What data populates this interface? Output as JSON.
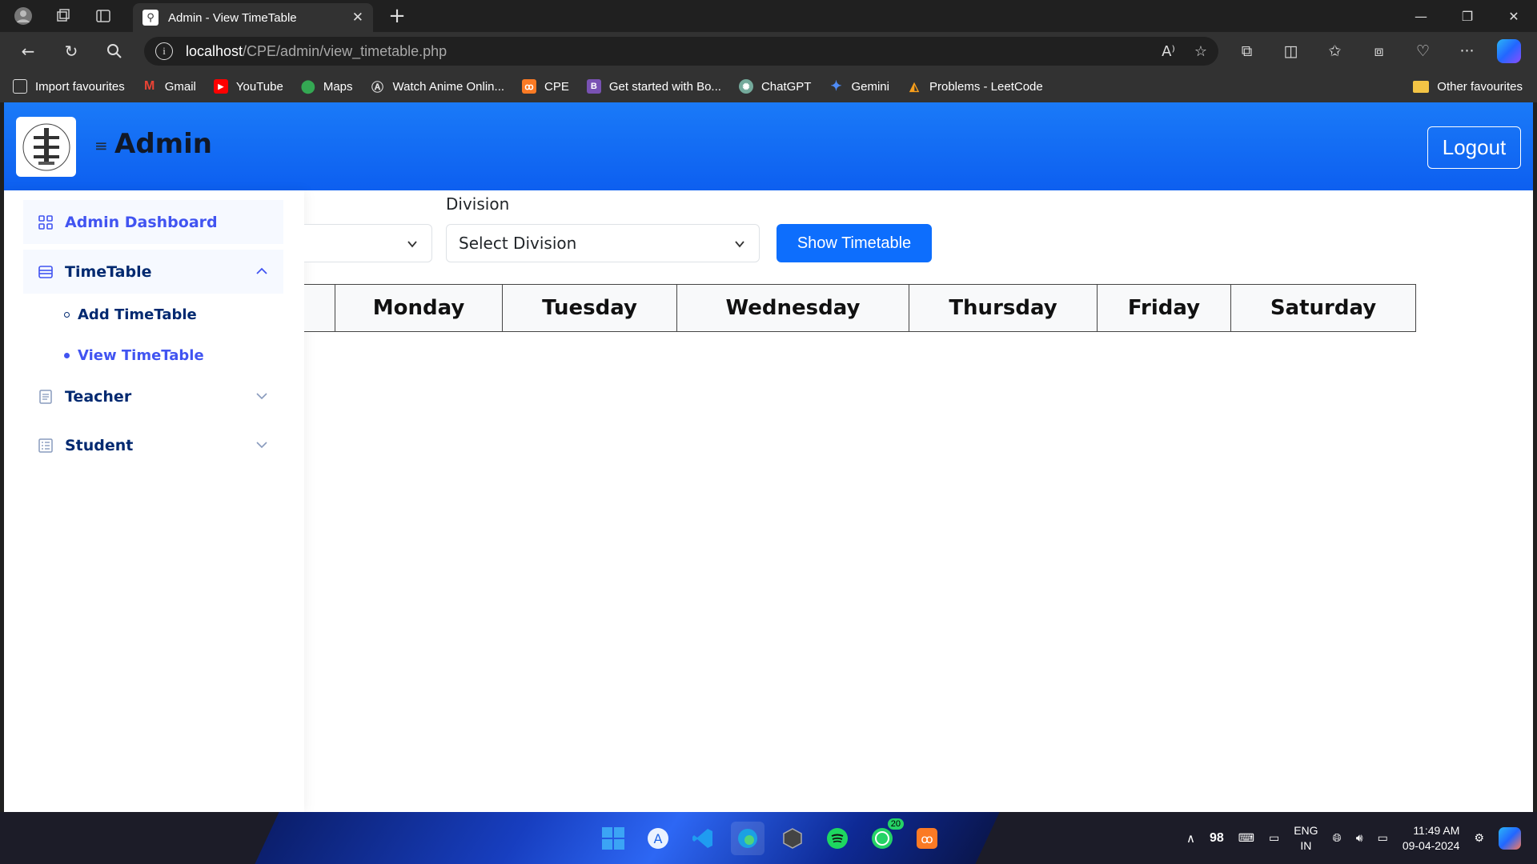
{
  "browser": {
    "tab_title": "Admin - View TimeTable",
    "url_host": "localhost",
    "url_path": "/CPE/admin/view_timetable.php"
  },
  "bookmarks": {
    "items": [
      {
        "label": "Import favourites",
        "icon": "import-icon",
        "color": "#555555"
      },
      {
        "label": "Gmail",
        "icon": "gmail-icon",
        "color": "#ea4335"
      },
      {
        "label": "YouTube",
        "icon": "youtube-icon",
        "color": "#ff0000"
      },
      {
        "label": "Maps",
        "icon": "maps-pin-icon",
        "color": "#34a853"
      },
      {
        "label": "Watch Anime Onlin...",
        "icon": "anime-icon",
        "color": "#666666"
      },
      {
        "label": "CPE",
        "icon": "xampp-icon",
        "color": "#fb7a24"
      },
      {
        "label": "Get started with Bo...",
        "icon": "bootstrap-icon",
        "color": "#7952b3"
      },
      {
        "label": "ChatGPT",
        "icon": "chatgpt-icon",
        "color": "#74aa9c"
      },
      {
        "label": "Gemini",
        "icon": "gemini-sparkle-icon",
        "color": "#4f8cf7"
      },
      {
        "label": "Problems - LeetCode",
        "icon": "leetcode-icon",
        "color": "#f89f1b"
      }
    ],
    "other": "Other favourites"
  },
  "header": {
    "brand": "Admin",
    "logout_label": "Logout",
    "color": "#0d6efd"
  },
  "sidebar": {
    "dashboard": "Admin Dashboard",
    "timetable": "TimeTable",
    "add_timetable": "Add TimeTable",
    "view_timetable": "View TimeTable",
    "teacher": "Teacher",
    "student": "Student"
  },
  "filters": {
    "division_label": "Division",
    "division_value": "Select Division",
    "show_button": "Show Timetable"
  },
  "timetable": {
    "days": [
      "Monday",
      "Tuesday",
      "Wednesday",
      "Thursday",
      "Friday",
      "Saturday"
    ]
  },
  "taskbar": {
    "badge_count": "20",
    "tray_number": "98",
    "lang_line1": "ENG",
    "lang_line2": "IN",
    "time": "11:49 AM",
    "date": "09-04-2024"
  }
}
